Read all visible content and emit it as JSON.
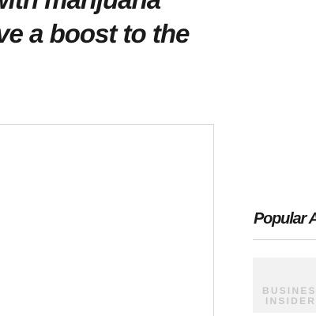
{
  "article": {
    "headline_line1": "with marijuana",
    "headline_line2": "ive a boost to the"
  },
  "sidebar": {
    "title": "Popular Ar",
    "thumbnail": {
      "logo_line1": "BUSINESS",
      "logo_line2": "INSIDER"
    }
  }
}
